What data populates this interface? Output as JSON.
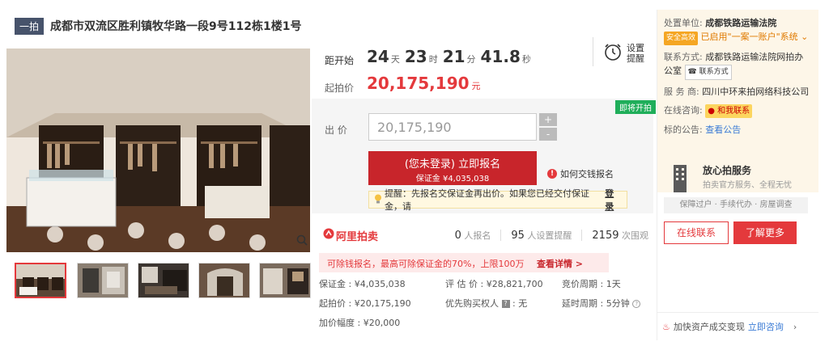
{
  "header": {
    "tag": "一拍",
    "title": "成都市双流区胜利镇牧华路一段9号112栋1楼1号"
  },
  "timer": {
    "label": "距开始",
    "days": "24",
    "days_unit": "天",
    "hours": "23",
    "hours_unit": "时",
    "minutes": "21",
    "minutes_unit": "分",
    "seconds": "41.8",
    "seconds_unit": "秒",
    "remind_line1": "设置",
    "remind_line2": "提醒"
  },
  "start_price": {
    "label": "起拍价",
    "value": "20,175,190",
    "unit": "元"
  },
  "bid": {
    "status_badge": "即将开拍",
    "label": "出 价",
    "input_value": "20,175,190",
    "plus": "+",
    "minus": "-",
    "signup_line1": "(您未登录) 立即报名",
    "signup_line2": "保证金 ¥4,035,038",
    "how_to": "如何交钱报名",
    "hint_text": "提醒：先报名交保证金再出价。如果您已经交付保证金，请",
    "hint_login": "登录"
  },
  "stats": {
    "logo": "阿里拍卖",
    "signups_count": "0",
    "signups_label": "人报名",
    "reminders_count": "95",
    "reminders_label": "人设置提醒",
    "views_count": "2159",
    "views_label": "次围观"
  },
  "promo": {
    "text": "可除钱报名，最高可除保证金的70%，上限100万",
    "link": "查看详情 >"
  },
  "info": {
    "deposit": "保证金 : ¥4,035,038",
    "appraisal": "评 估 价 : ¥28,821,700",
    "cycle": "竞价周期 : 1天",
    "start": "起拍价 : ¥20,175,190",
    "priority_label": "优先购买权人",
    "priority_value": "无",
    "delay": "延时周期 : 5分钟",
    "increment": "加价幅度 : ¥20,000"
  },
  "sidebar": {
    "unit_key": "处置单位:",
    "unit_value": "成都铁路运输法院",
    "safe_badge": "安全高效",
    "enabled_text": "已启用\"一案一账户\"系统",
    "contact_key": "联系方式:",
    "contact_value": "成都铁路运输法院网拍办公室",
    "contact_btn": "联系方式",
    "service_key": "服 务 商:",
    "service_value": "四川中环来拍网络科技公司",
    "consult_key": "在线咨询:",
    "consult_pill": "和我联系",
    "notice_key": "标的公告:",
    "notice_link": "查看公告",
    "fang_title": "放心拍服务",
    "fang_sub": "拍卖官方服务、全程无忧",
    "guarantee": "保障过户 · 手续代办 · 房屋调查",
    "btn_online": "在线联系",
    "btn_more": "了解更多",
    "bottom_text": "加快资产成交变现",
    "bottom_link": "立即咨询"
  }
}
